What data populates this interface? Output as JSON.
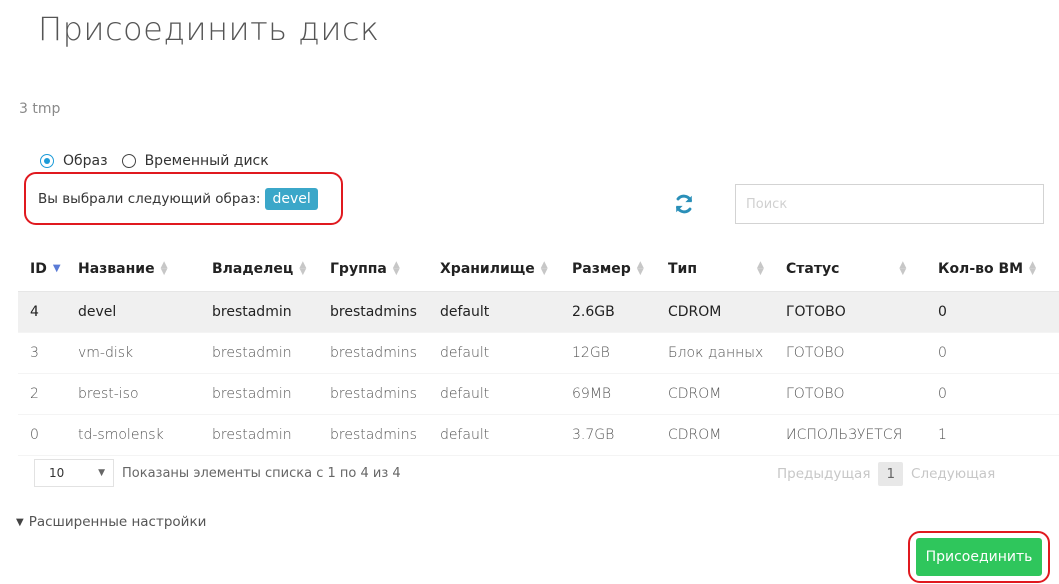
{
  "dialog": {
    "title": "Присоединить диск",
    "subtitle": "3 tmp"
  },
  "radios": [
    {
      "label": "Образ",
      "checked": true
    },
    {
      "label": "Временный диск",
      "checked": false
    }
  ],
  "selection": {
    "text": "Вы выбрали следующий образ:",
    "tag": "devel"
  },
  "search": {
    "placeholder": "Поиск"
  },
  "table": {
    "columns": [
      "ID",
      "Название",
      "Владелец",
      "Группа",
      "Хранилище",
      "Размер",
      "Тип",
      "Статус",
      "Кол-во ВМ"
    ],
    "rows": [
      [
        "4",
        "devel",
        "brestadmin",
        "brestadmins",
        "default",
        "2.6GB",
        "CDROM",
        "ГОТОВО",
        "0"
      ],
      [
        "3",
        "vm-disk",
        "brestadmin",
        "brestadmins",
        "default",
        "12GB",
        "Блок данных",
        "ГОТОВО",
        "0"
      ],
      [
        "2",
        "brest-iso",
        "brestadmin",
        "brestadmins",
        "default",
        "69MB",
        "CDROM",
        "ГОТОВО",
        "0"
      ],
      [
        "0",
        "td-smolensk",
        "brestadmin",
        "brestadmins",
        "default",
        "3.7GB",
        "CDROM",
        "ИСПОЛЬЗУЕТСЯ",
        "1"
      ]
    ]
  },
  "pagination": {
    "page_size": "10",
    "info": "Показаны элементы списка с 1 по 4 из 4",
    "prev": "Предыдущая",
    "current": "1",
    "next": "Следующая"
  },
  "advanced": {
    "label": "Расширенные настройки"
  },
  "actions": {
    "attach": "Присоединить"
  },
  "colors": {
    "accent": "#1c9bd8",
    "tag": "#3ba7c9",
    "attach": "#2fc65c",
    "highlight": "#e0191f"
  }
}
